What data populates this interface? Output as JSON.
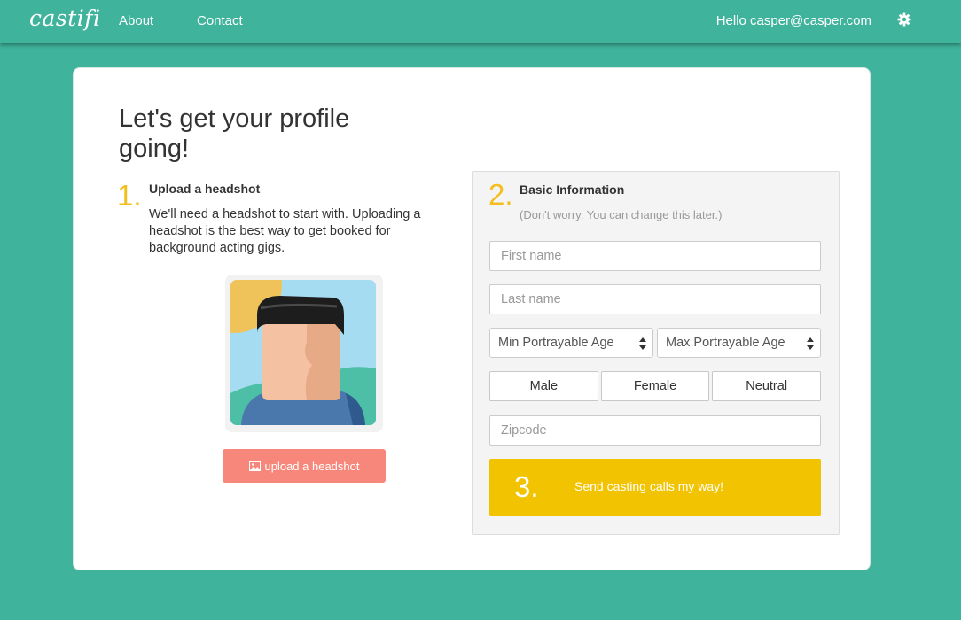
{
  "nav": {
    "logo": "castifi",
    "about": "About",
    "contact": "Contact",
    "greeting": "Hello casper@casper.com",
    "settings_icon": "gear-icon"
  },
  "card": {
    "title": "Let's get your profile going!",
    "step1": {
      "number": "1.",
      "title": "Upload a headshot",
      "description": "We'll need a headshot to start with. Uploading a headshot is the best way to get booked for background acting gigs.",
      "placeholder_image": "avatar-illustration",
      "upload_button": "upload a headshot",
      "upload_icon": "image-icon"
    },
    "step2": {
      "number": "2.",
      "title": "Basic Information",
      "subtitle": "(Don't worry. You can change this later.)",
      "first_name_placeholder": "First name",
      "last_name_placeholder": "Last name",
      "min_age": "Min Portrayable Age",
      "max_age": "Max Portrayable Age",
      "genders": [
        "Male",
        "Female",
        "Neutral"
      ],
      "zipcode_placeholder": "Zipcode"
    },
    "step3": {
      "number": "3.",
      "label": "Send casting calls my way!"
    }
  },
  "colors": {
    "background": "#3fb39c",
    "accent_yellow": "#f2c300",
    "upload_button": "#f7877a"
  }
}
